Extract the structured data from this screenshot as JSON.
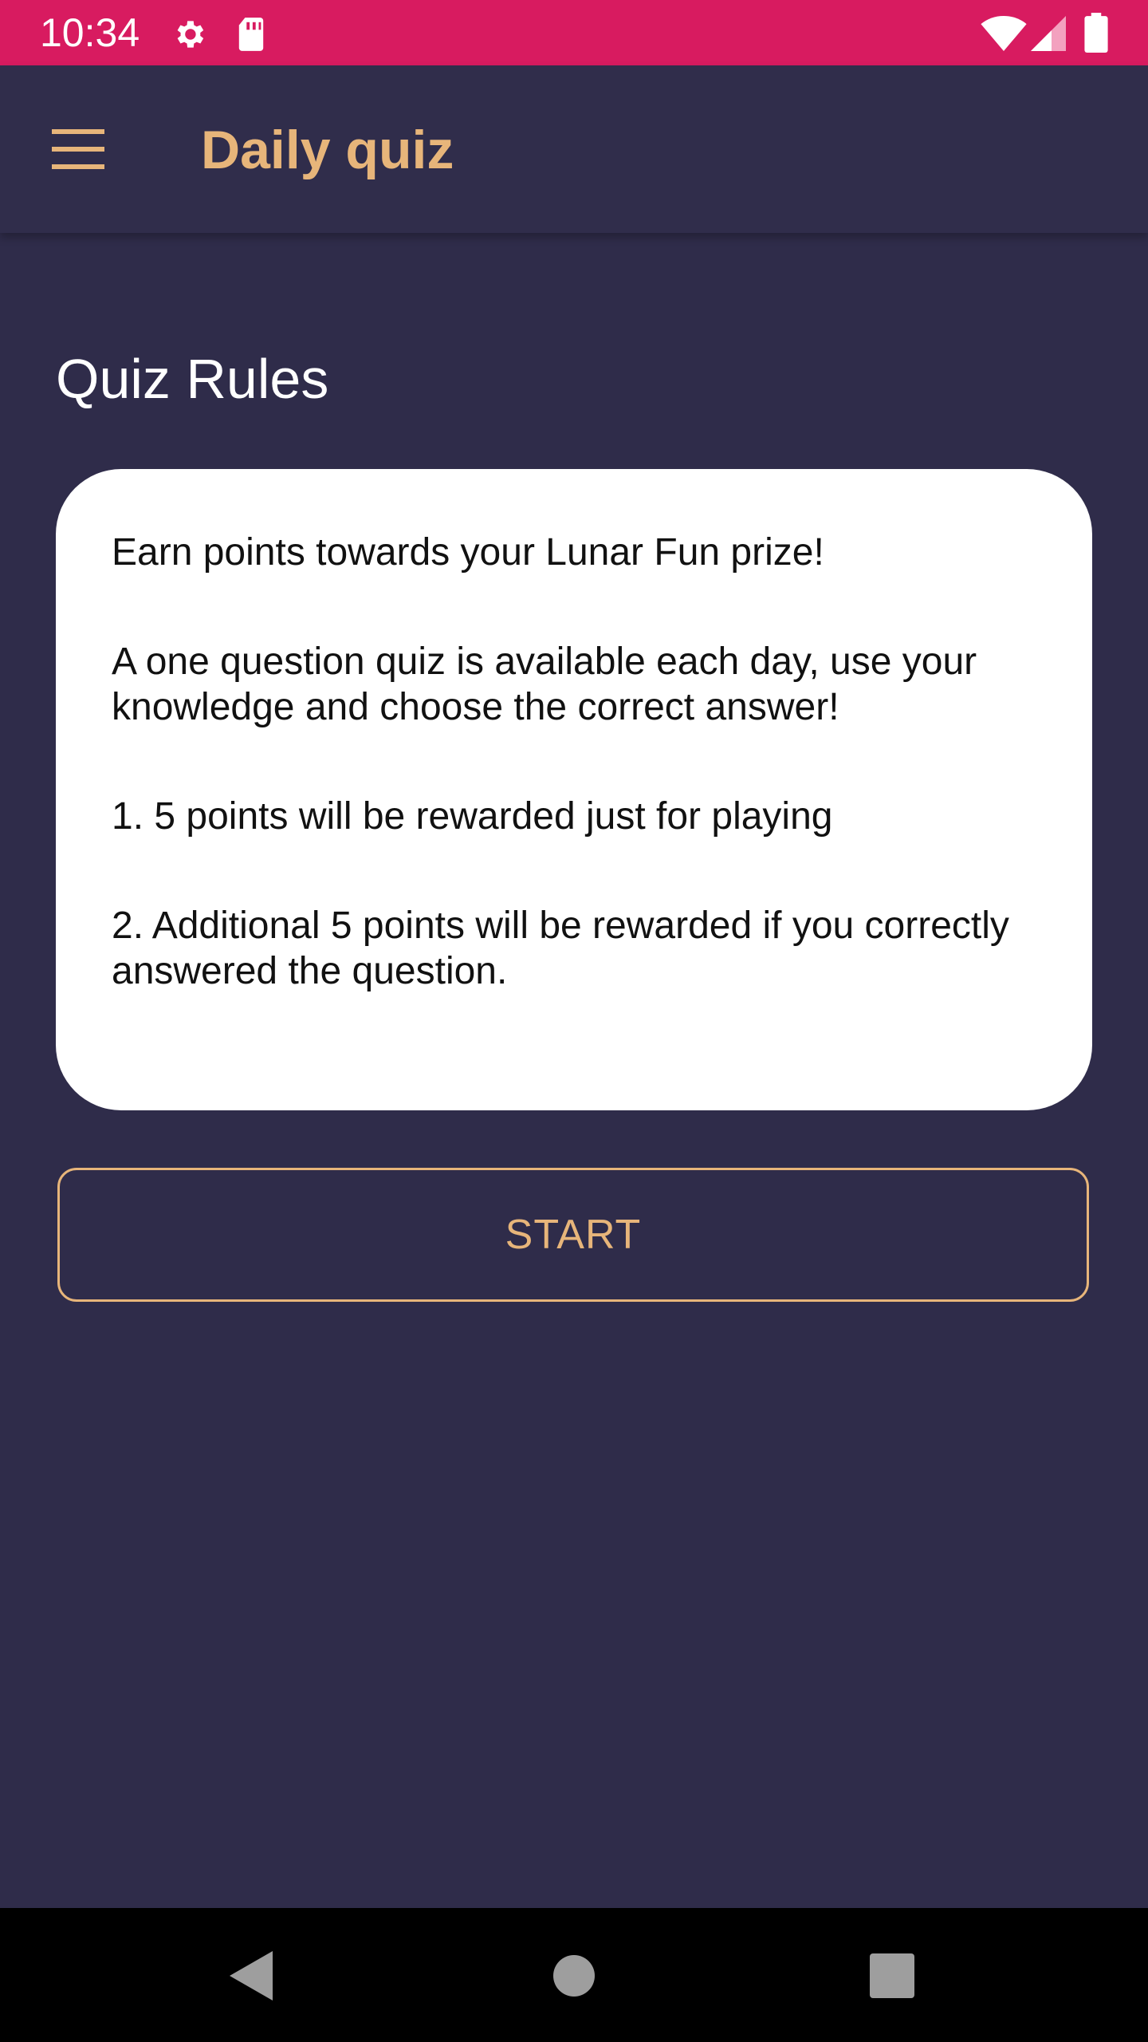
{
  "status_bar": {
    "time": "10:34",
    "icons": [
      "settings-icon",
      "sd-card-icon",
      "wifi-icon",
      "signal-icon",
      "battery-icon"
    ]
  },
  "app_bar": {
    "title": "Daily quiz",
    "menu_icon": "menu-icon"
  },
  "content": {
    "section_title": "Quiz Rules",
    "rules": [
      "Earn points towards your Lunar Fun prize!",
      "A one question quiz is available each day, use your knowledge and choose the correct answer!",
      "1. 5 points will be rewarded just for playing",
      "2. Additional 5 points will be rewarded if you correctly answered the question."
    ],
    "start_label": "START"
  },
  "nav_bar": {
    "items": [
      "back-icon",
      "home-icon",
      "recents-icon"
    ]
  },
  "colors": {
    "status_bar": "#d81b60",
    "background": "#2f2c4a",
    "accent": "#e7b57a",
    "card": "#ffffff"
  }
}
